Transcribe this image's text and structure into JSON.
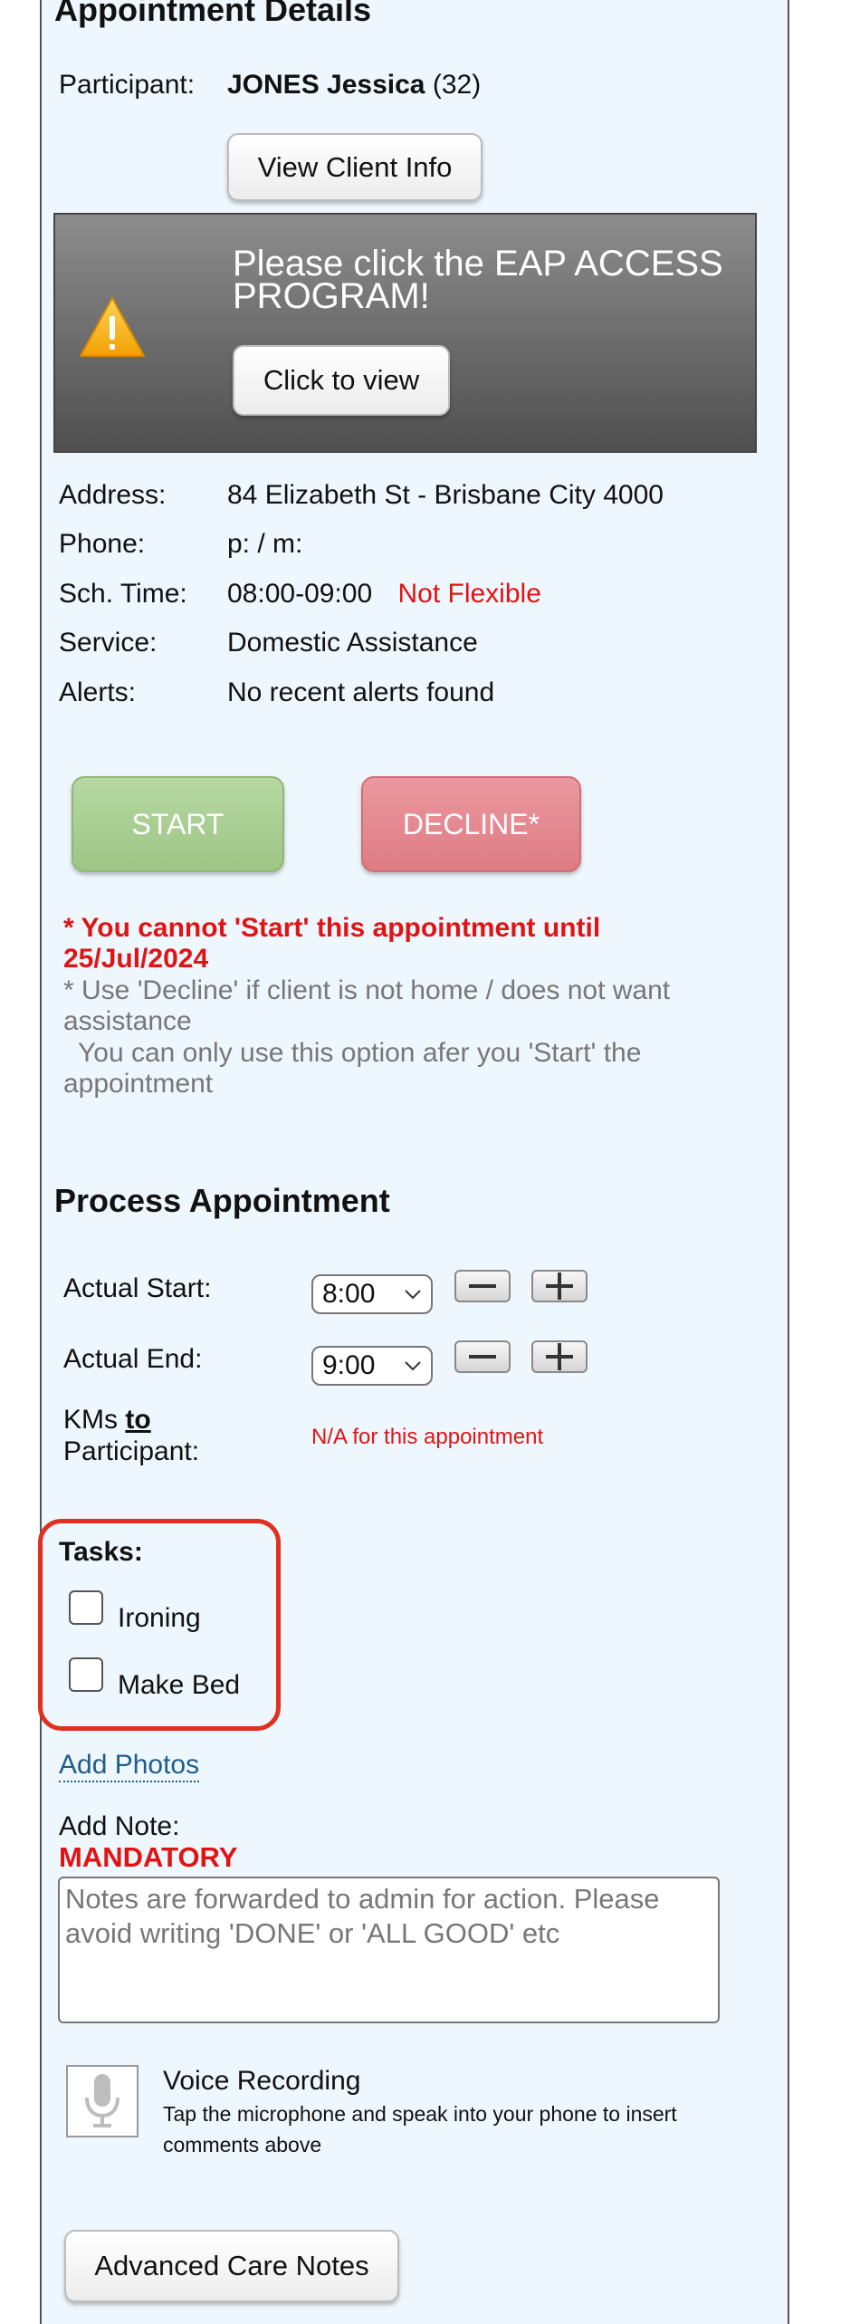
{
  "appointment": {
    "heading": "Appointment Details",
    "participant_label": "Participant:",
    "participant_name": "JONES Jessica",
    "participant_age": "(32)",
    "view_client_button": "View Client Info",
    "eap_title": "Please click the EAP ACCESS PROGRAM!",
    "eap_button": "Click to view",
    "address_label": "Address:",
    "address_value": "84 Elizabeth St - Brisbane City 4000",
    "phone_label": "Phone:",
    "phone_value": "p: / m:",
    "time_label": "Sch. Time:",
    "time_value": "08:00-09:00",
    "time_flag": "Not Flexible",
    "service_label": "Service:",
    "service_value": "Domestic Assistance",
    "alerts_label": "Alerts:",
    "alerts_value": "No recent alerts found",
    "start_button": "START",
    "decline_button": "DECLINE*",
    "warning_start": "* You cannot 'Start' this appointment until 25/Jul/2024",
    "info_decline": "* Use 'Decline' if client is not home / does not want assistance",
    "info_option": "You can only use this option afer you 'Start' the appointment"
  },
  "process": {
    "heading": "Process Appointment",
    "actual_start_label": "Actual Start:",
    "actual_start_value": "8:00",
    "actual_end_label": "Actual End:",
    "actual_end_value": "9:00",
    "kms_label_prefix": "KMs ",
    "kms_label_to": "to",
    "kms_label_suffix": "Participant:",
    "kms_value": "N/A for this appointment",
    "tasks_label": "Tasks:",
    "tasks": [
      {
        "label": "Ironing",
        "checked": false
      },
      {
        "label": "Make Bed",
        "checked": false
      }
    ],
    "add_photos": "Add Photos",
    "add_note_label": "Add Note:",
    "mandatory": "MANDATORY",
    "note_placeholder": "Notes are forwarded to admin for action. Please avoid writing 'DONE' or 'ALL GOOD' etc",
    "voice_title": "Voice Recording",
    "voice_desc": "Tap the microphone and speak into your phone to insert comments above",
    "advanced_notes_button": "Advanced Care Notes"
  },
  "colors": {
    "panel_bg": "#eef7fd",
    "start_green": "#a9cf91",
    "decline_red": "#e58a90",
    "alert_red": "#e01414",
    "highlight_red": "#e0301f",
    "link_blue": "#1f5d8c"
  },
  "icons": {
    "warning": "warning-triangle-icon",
    "minus": "minus-icon",
    "plus": "plus-icon",
    "chevron": "chevron-down-icon",
    "microphone": "microphone-icon"
  }
}
